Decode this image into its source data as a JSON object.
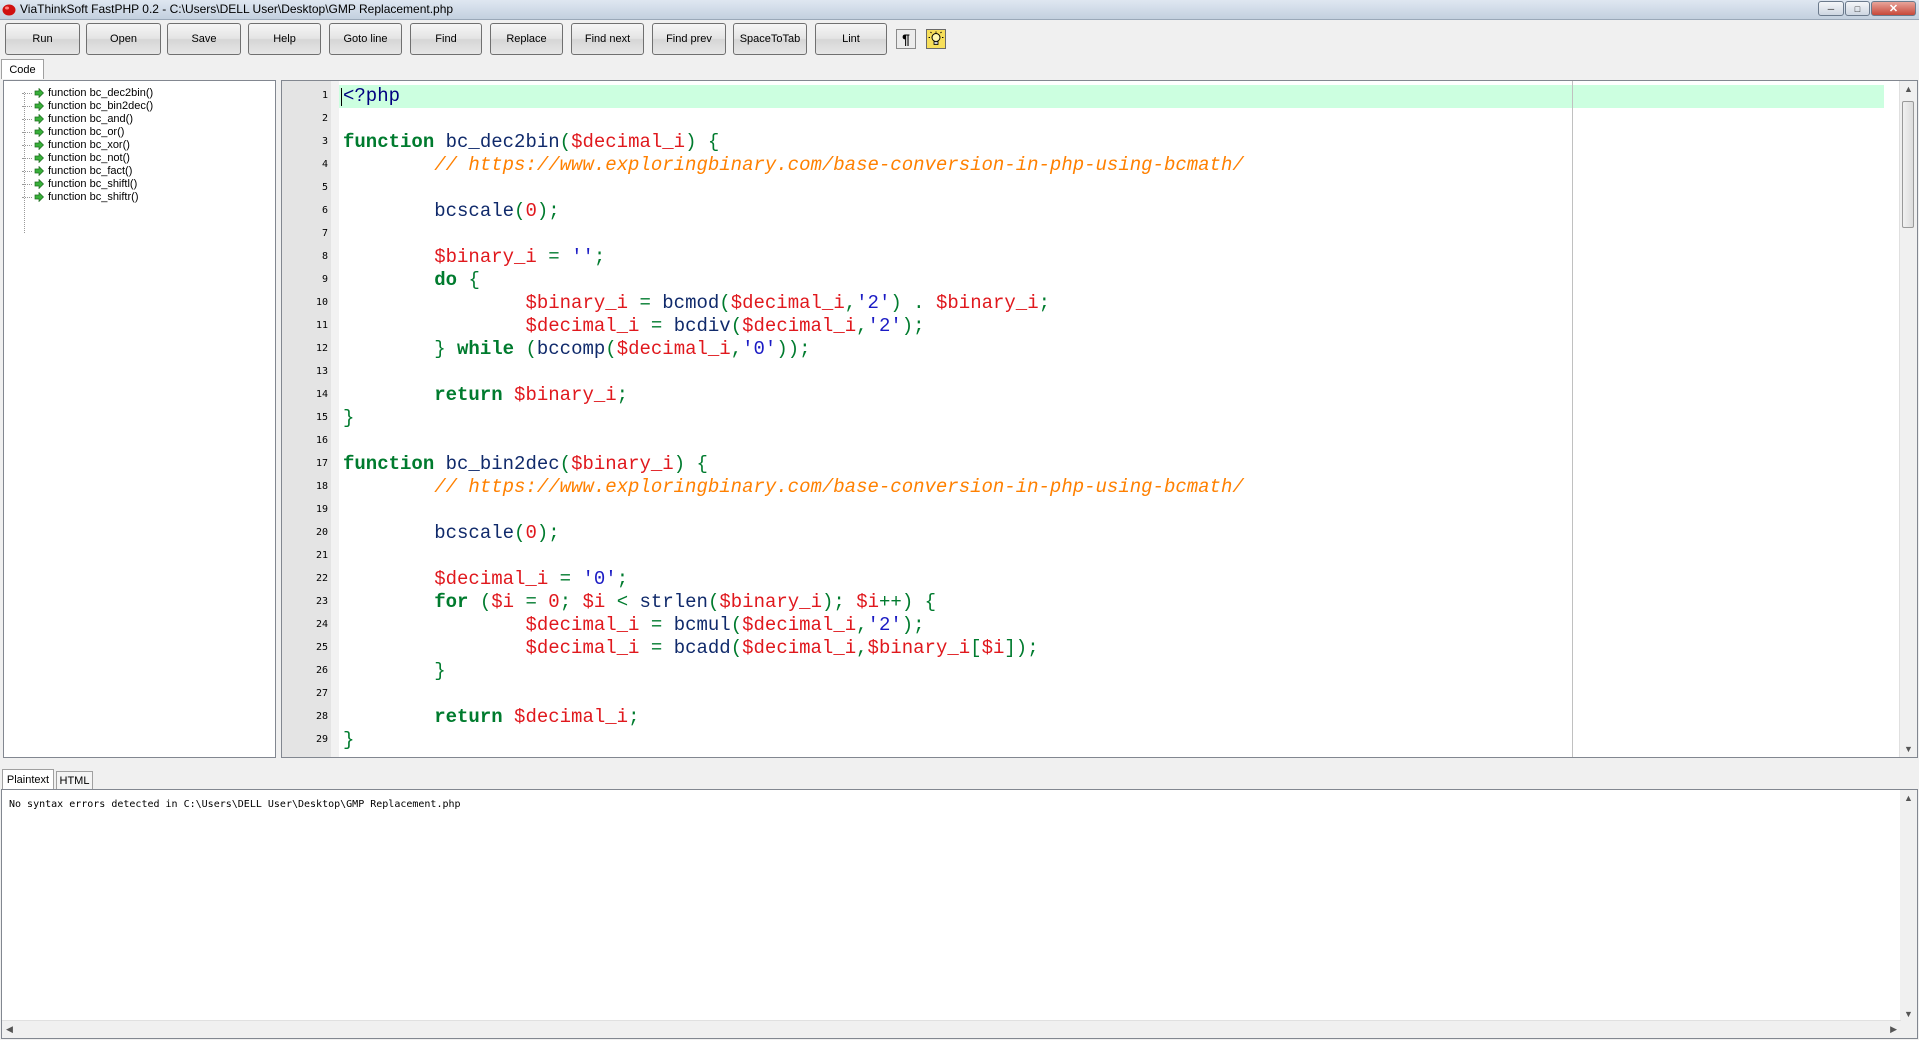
{
  "window": {
    "title": "ViaThinkSoft FastPHP 0.2 - C:\\Users\\DELL User\\Desktop\\GMP Replacement.php",
    "minimize_glyph": "─",
    "maximize_glyph": "□",
    "close_glyph": "✕"
  },
  "toolbar": {
    "run": "Run",
    "open": "Open",
    "save": "Save",
    "help": "Help",
    "goto_line": "Goto line",
    "find": "Find",
    "replace": "Replace",
    "find_next": "Find next",
    "find_prev": "Find prev",
    "space_to_tab": "SpaceToTab",
    "lint": "Lint",
    "pilcrow": "¶",
    "pilcrow_icon": "pilcrow-icon",
    "lightbulb_icon": "lightbulb-icon"
  },
  "top_tabs": {
    "code": "Code"
  },
  "outline": {
    "items": [
      "function bc_dec2bin()",
      "function bc_bin2dec()",
      "function bc_and()",
      "function bc_or()",
      "function bc_xor()",
      "function bc_not()",
      "function bc_fact()",
      "function bc_shiftl()",
      "function bc_shiftr()"
    ],
    "item_icon": "green-arrow-icon"
  },
  "editor": {
    "highlight_color": "#ccffe0",
    "lines": [
      [
        [
          "tag",
          "<?php"
        ]
      ],
      [],
      [
        [
          "kw",
          "function"
        ],
        [
          "p",
          " "
        ],
        [
          "fn",
          "bc_dec2bin"
        ],
        [
          "op",
          "("
        ],
        [
          "var",
          "$decimal_i"
        ],
        [
          "op",
          ")"
        ],
        [
          "p",
          " "
        ],
        [
          "op",
          "{"
        ]
      ],
      [
        [
          "p",
          "        "
        ],
        [
          "cm",
          "// https://www.exploringbinary.com/base-conversion-in-php-using-bcmath/"
        ]
      ],
      [],
      [
        [
          "p",
          "        "
        ],
        [
          "fn",
          "bcscale"
        ],
        [
          "op",
          "("
        ],
        [
          "num",
          "0"
        ],
        [
          "op",
          ");"
        ]
      ],
      [],
      [
        [
          "p",
          "        "
        ],
        [
          "var",
          "$binary_i"
        ],
        [
          "p",
          " "
        ],
        [
          "op",
          "="
        ],
        [
          "p",
          " "
        ],
        [
          "str",
          "''"
        ],
        [
          "op",
          ";"
        ]
      ],
      [
        [
          "p",
          "        "
        ],
        [
          "kw",
          "do"
        ],
        [
          "p",
          " "
        ],
        [
          "op",
          "{"
        ]
      ],
      [
        [
          "p",
          "                "
        ],
        [
          "var",
          "$binary_i"
        ],
        [
          "p",
          " "
        ],
        [
          "op",
          "="
        ],
        [
          "p",
          " "
        ],
        [
          "fn",
          "bcmod"
        ],
        [
          "op",
          "("
        ],
        [
          "var",
          "$decimal_i"
        ],
        [
          "op",
          ","
        ],
        [
          "str",
          "'2'"
        ],
        [
          "op",
          ")"
        ],
        [
          "p",
          " "
        ],
        [
          "op",
          "."
        ],
        [
          "p",
          " "
        ],
        [
          "var",
          "$binary_i"
        ],
        [
          "op",
          ";"
        ]
      ],
      [
        [
          "p",
          "                "
        ],
        [
          "var",
          "$decimal_i"
        ],
        [
          "p",
          " "
        ],
        [
          "op",
          "="
        ],
        [
          "p",
          " "
        ],
        [
          "fn",
          "bcdiv"
        ],
        [
          "op",
          "("
        ],
        [
          "var",
          "$decimal_i"
        ],
        [
          "op",
          ","
        ],
        [
          "str",
          "'2'"
        ],
        [
          "op",
          ");"
        ]
      ],
      [
        [
          "p",
          "        "
        ],
        [
          "op",
          "}"
        ],
        [
          "p",
          " "
        ],
        [
          "kw",
          "while"
        ],
        [
          "p",
          " "
        ],
        [
          "op",
          "("
        ],
        [
          "fn",
          "bccomp"
        ],
        [
          "op",
          "("
        ],
        [
          "var",
          "$decimal_i"
        ],
        [
          "op",
          ","
        ],
        [
          "str",
          "'0'"
        ],
        [
          "op",
          "));"
        ]
      ],
      [],
      [
        [
          "p",
          "        "
        ],
        [
          "kw",
          "return"
        ],
        [
          "p",
          " "
        ],
        [
          "var",
          "$binary_i"
        ],
        [
          "op",
          ";"
        ]
      ],
      [
        [
          "op",
          "}"
        ]
      ],
      [],
      [
        [
          "kw",
          "function"
        ],
        [
          "p",
          " "
        ],
        [
          "fn",
          "bc_bin2dec"
        ],
        [
          "op",
          "("
        ],
        [
          "var",
          "$binary_i"
        ],
        [
          "op",
          ")"
        ],
        [
          "p",
          " "
        ],
        [
          "op",
          "{"
        ]
      ],
      [
        [
          "p",
          "        "
        ],
        [
          "cm",
          "// https://www.exploringbinary.com/base-conversion-in-php-using-bcmath/"
        ]
      ],
      [],
      [
        [
          "p",
          "        "
        ],
        [
          "fn",
          "bcscale"
        ],
        [
          "op",
          "("
        ],
        [
          "num",
          "0"
        ],
        [
          "op",
          ");"
        ]
      ],
      [],
      [
        [
          "p",
          "        "
        ],
        [
          "var",
          "$decimal_i"
        ],
        [
          "p",
          " "
        ],
        [
          "op",
          "="
        ],
        [
          "p",
          " "
        ],
        [
          "str",
          "'0'"
        ],
        [
          "op",
          ";"
        ]
      ],
      [
        [
          "p",
          "        "
        ],
        [
          "kw",
          "for"
        ],
        [
          "p",
          " "
        ],
        [
          "op",
          "("
        ],
        [
          "var",
          "$i"
        ],
        [
          "p",
          " "
        ],
        [
          "op",
          "="
        ],
        [
          "p",
          " "
        ],
        [
          "num",
          "0"
        ],
        [
          "op",
          ";"
        ],
        [
          "p",
          " "
        ],
        [
          "var",
          "$i"
        ],
        [
          "p",
          " "
        ],
        [
          "op",
          "<"
        ],
        [
          "p",
          " "
        ],
        [
          "fn",
          "strlen"
        ],
        [
          "op",
          "("
        ],
        [
          "var",
          "$binary_i"
        ],
        [
          "op",
          ");"
        ],
        [
          "p",
          " "
        ],
        [
          "var",
          "$i"
        ],
        [
          "op",
          "++)"
        ],
        [
          "p",
          " "
        ],
        [
          "op",
          "{"
        ]
      ],
      [
        [
          "p",
          "                "
        ],
        [
          "var",
          "$decimal_i"
        ],
        [
          "p",
          " "
        ],
        [
          "op",
          "="
        ],
        [
          "p",
          " "
        ],
        [
          "fn",
          "bcmul"
        ],
        [
          "op",
          "("
        ],
        [
          "var",
          "$decimal_i"
        ],
        [
          "op",
          ","
        ],
        [
          "str",
          "'2'"
        ],
        [
          "op",
          ");"
        ]
      ],
      [
        [
          "p",
          "                "
        ],
        [
          "var",
          "$decimal_i"
        ],
        [
          "p",
          " "
        ],
        [
          "op",
          "="
        ],
        [
          "p",
          " "
        ],
        [
          "fn",
          "bcadd"
        ],
        [
          "op",
          "("
        ],
        [
          "var",
          "$decimal_i"
        ],
        [
          "op",
          ","
        ],
        [
          "var",
          "$binary_i"
        ],
        [
          "op",
          "["
        ],
        [
          "var",
          "$i"
        ],
        [
          "op",
          "]);"
        ]
      ],
      [
        [
          "p",
          "        "
        ],
        [
          "op",
          "}"
        ]
      ],
      [],
      [
        [
          "p",
          "        "
        ],
        [
          "kw",
          "return"
        ],
        [
          "p",
          " "
        ],
        [
          "var",
          "$decimal_i"
        ],
        [
          "op",
          ";"
        ]
      ],
      [
        [
          "op",
          "}"
        ]
      ]
    ]
  },
  "bottom_tabs": {
    "plaintext": "Plaintext",
    "html": "HTML"
  },
  "output": {
    "text": "No syntax errors detected in C:\\Users\\DELL User\\Desktop\\GMP Replacement.php"
  },
  "scroll": {
    "up": "▲",
    "down": "▼",
    "left": "◀",
    "right": "▶"
  }
}
